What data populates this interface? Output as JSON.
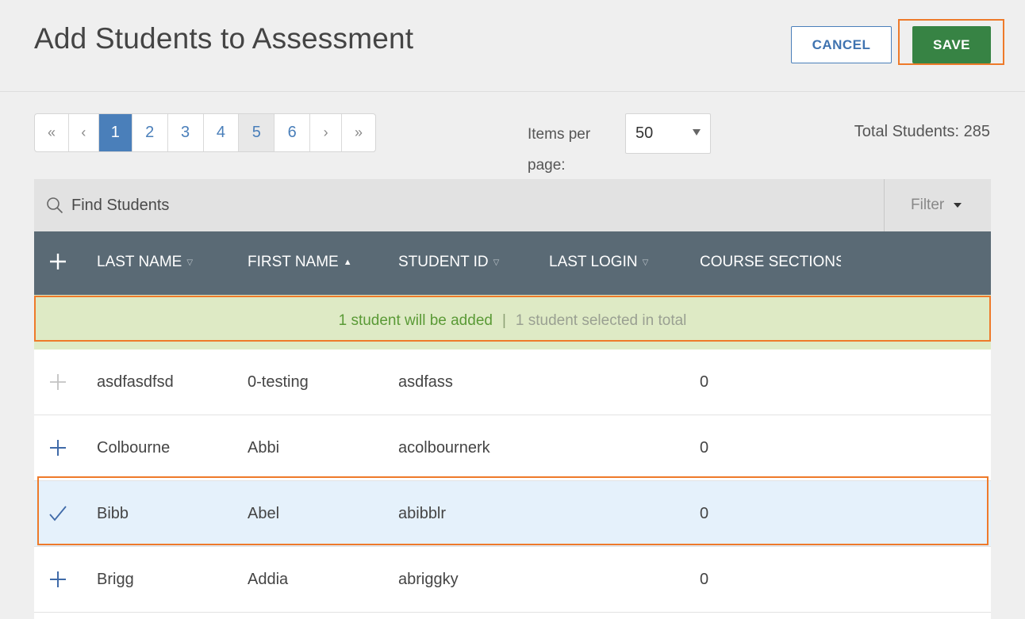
{
  "header": {
    "title": "Add Students to Assessment",
    "cancel_label": "CANCEL",
    "save_label": "SAVE"
  },
  "pagination": {
    "first": "«",
    "prev": "‹",
    "pages": [
      "1",
      "2",
      "3",
      "4",
      "5",
      "6"
    ],
    "active_page": "1",
    "next": "›",
    "last": "»"
  },
  "items_per_page": {
    "label": "Items per page:",
    "value": "50"
  },
  "total_students": "Total Students: 285",
  "search": {
    "placeholder": "Find Students",
    "filter_label": "Filter"
  },
  "table": {
    "columns": {
      "last_name": "LAST NAME",
      "first_name": "FIRST NAME",
      "student_id": "STUDENT ID",
      "last_login": "LAST LOGIN",
      "course_sections": "COURSE SECTIONS"
    },
    "sort_column": "first_name",
    "sort_direction": "ascending",
    "rows": [
      {
        "last": "asdfasdfsd",
        "first": "0-testing",
        "id": "asdfass",
        "login": "",
        "sections": "0",
        "state": "disabled"
      },
      {
        "last": "Colbourne",
        "first": "Abbi",
        "id": "acolbournerk",
        "login": "",
        "sections": "0",
        "state": "addable"
      },
      {
        "last": "Bibb",
        "first": "Abel",
        "id": "abibblr",
        "login": "",
        "sections": "0",
        "state": "selected"
      },
      {
        "last": "Brigg",
        "first": "Addia",
        "id": "abriggky",
        "login": "",
        "sections": "0",
        "state": "addable"
      }
    ]
  },
  "banner": {
    "added": "1 student will be added",
    "separator": "|",
    "total": "1 student selected in total"
  },
  "colors": {
    "primary": "#4a7fba",
    "save": "#378344",
    "header_bg": "#5a6a75",
    "banner_bg": "#deeac5",
    "selected_row": "#e5f1fb",
    "highlight": "#ee7a2a"
  }
}
